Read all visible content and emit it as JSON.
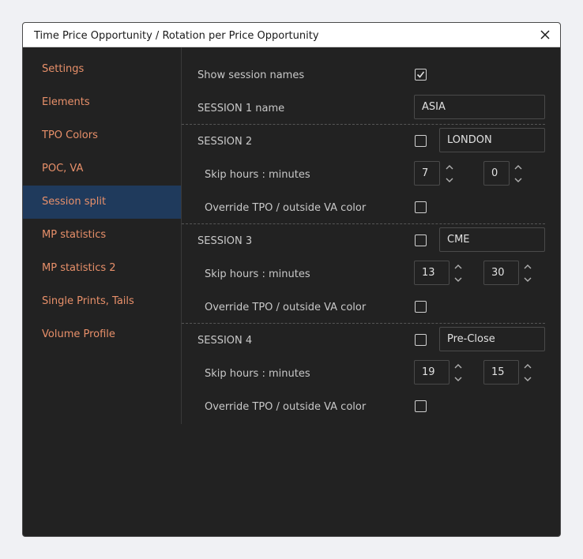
{
  "dialog": {
    "title": "Time Price Opportunity / Rotation per Price Opportunity",
    "close_icon": "close-icon"
  },
  "sidebar": {
    "items": [
      {
        "label": "Settings"
      },
      {
        "label": "Elements"
      },
      {
        "label": "TPO Colors"
      },
      {
        "label": "POC, VA"
      },
      {
        "label": "Session split",
        "active": true
      },
      {
        "label": "MP statistics"
      },
      {
        "label": "MP statistics 2"
      },
      {
        "label": "Single Prints, Tails"
      },
      {
        "label": "Volume Profile"
      }
    ]
  },
  "settings": {
    "show_session_names": {
      "label": "Show session names",
      "checked": true
    },
    "session1": {
      "label": "SESSION 1 name",
      "value": "ASIA"
    },
    "session2": {
      "label": "SESSION 2",
      "enabled": false,
      "name": "LONDON",
      "skip_label": "Skip hours : minutes",
      "hours": "7",
      "minutes": "0",
      "override_label": "Override TPO / outside VA color",
      "override": false
    },
    "session3": {
      "label": "SESSION 3",
      "enabled": false,
      "name": "CME",
      "skip_label": "Skip hours : minutes",
      "hours": "13",
      "minutes": "30",
      "override_label": "Override TPO / outside VA color",
      "override": false
    },
    "session4": {
      "label": "SESSION 4",
      "enabled": false,
      "name": "Pre-Close",
      "skip_label": "Skip hours : minutes",
      "hours": "19",
      "minutes": "15",
      "override_label": "Override TPO / outside VA color",
      "override": false
    }
  },
  "colors": {
    "accent": "#e8906a",
    "active_bg": "#1f3a5c",
    "panel_bg": "#222222"
  }
}
